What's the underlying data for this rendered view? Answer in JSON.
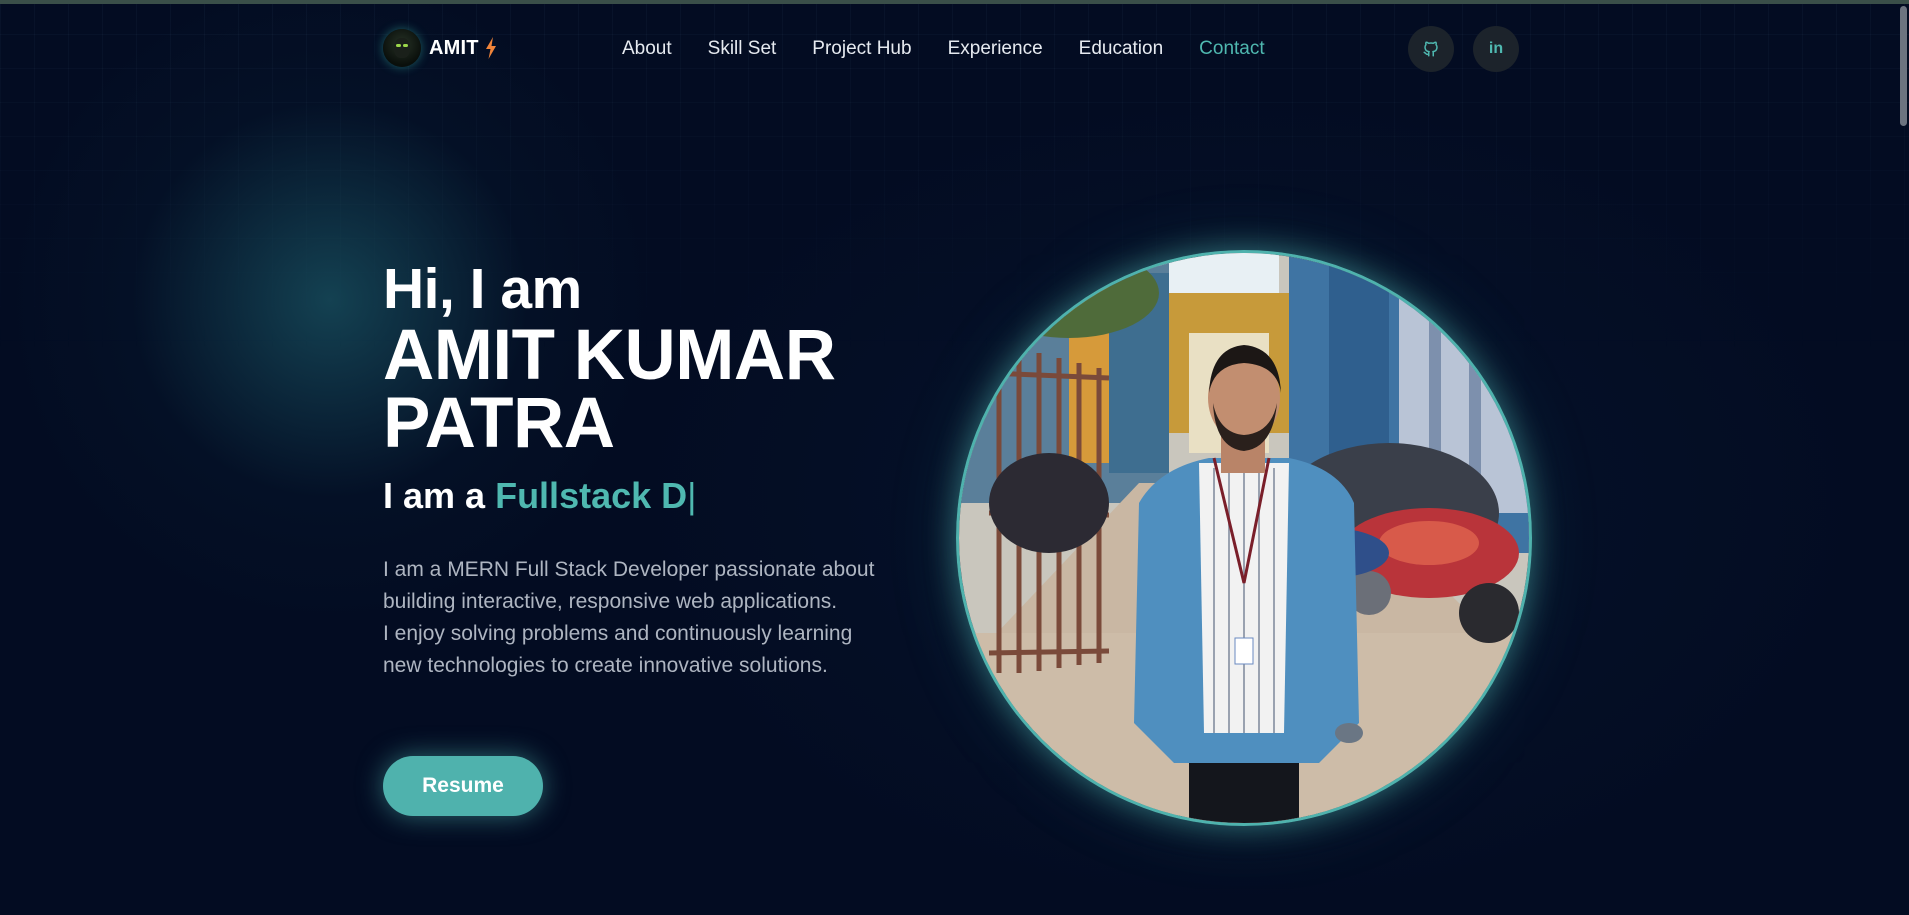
{
  "brand": {
    "name": "AMIT",
    "logo_icon": "avatar-icon",
    "accent_icon": "lightning-bolt-icon"
  },
  "nav": {
    "items": [
      {
        "label": "About",
        "active": false
      },
      {
        "label": "Skill Set",
        "active": false
      },
      {
        "label": "Project Hub",
        "active": false
      },
      {
        "label": "Experience",
        "active": false
      },
      {
        "label": "Education",
        "active": false
      },
      {
        "label": "Contact",
        "active": true
      }
    ],
    "social": [
      {
        "icon": "github-icon"
      },
      {
        "icon": "linkedin-icon",
        "text": "in"
      }
    ]
  },
  "hero": {
    "greeting": "Hi, I am",
    "name_line1": "AMIT KUMAR",
    "name_line2": "PATRA",
    "role_prefix": "I am a",
    "role_typed": "Fullstack D",
    "caret": "|",
    "bio_lines": [
      "I am a MERN Full Stack Developer passionate about",
      "building interactive, responsive web applications.",
      "I enjoy solving problems and continuously learning",
      "new technologies to create innovative solutions."
    ],
    "resume_label": "Resume"
  },
  "colors": {
    "background": "#030c22",
    "accent": "#4fb2ad",
    "text": "#ffffff",
    "muted": "#aeb5c1",
    "bolt": "#f0843a"
  }
}
